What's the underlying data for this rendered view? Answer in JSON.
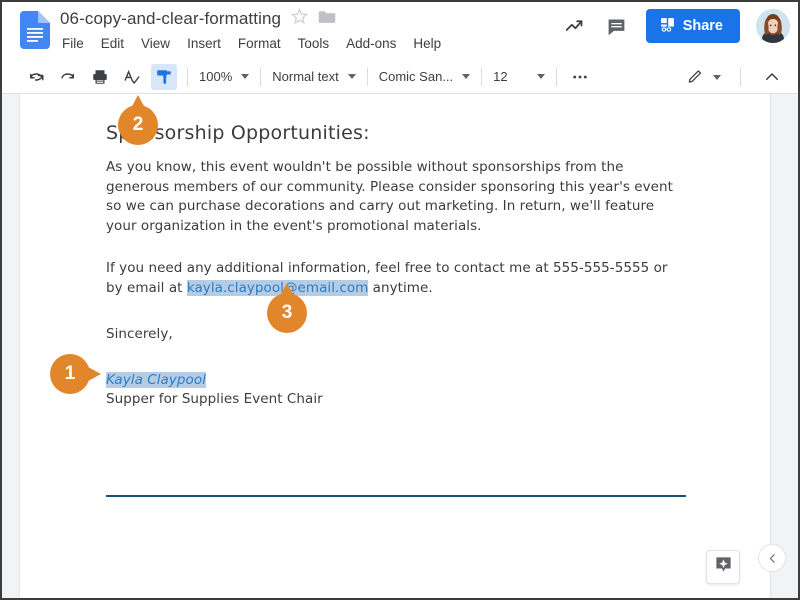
{
  "window": {
    "app": "Google Docs"
  },
  "header": {
    "doc_icon": "google-docs-icon",
    "title": "06-copy-and-clear-formatting",
    "star_icon": "star-outline-icon",
    "folder_icon": "folder-icon",
    "menus": [
      {
        "label": "File"
      },
      {
        "label": "Edit"
      },
      {
        "label": "View"
      },
      {
        "label": "Insert"
      },
      {
        "label": "Format"
      },
      {
        "label": "Tools"
      },
      {
        "label": "Add-ons"
      },
      {
        "label": "Help"
      }
    ],
    "activity_icon": "trending-up-icon",
    "comment_icon": "comment-icon",
    "share": {
      "label": "Share",
      "icon": "share-lock-icon",
      "color": "#1a73e8"
    },
    "avatar": "user-avatar"
  },
  "toolbar": {
    "undo_icon": "undo-icon",
    "redo_icon": "redo-icon",
    "print_icon": "print-icon",
    "spellcheck_icon": "spellcheck-icon",
    "paint_format_icon": "paint-format-icon",
    "paint_format_active": true,
    "zoom_value": "100%",
    "style_value": "Normal text",
    "font_value": "Comic San...",
    "size_value": "12",
    "more_icon": "more-horizontal-icon",
    "edit_mode_icon": "pencil-icon",
    "collapse_icon": "chevron-up-icon"
  },
  "document": {
    "heading": "Sponsorship Opportunities:",
    "paragraph1": "As you know, this event wouldn't be possible without sponsorships from the generous members of our community. Please consider sponsoring this year's event so we can purchase decorations and carry out marketing. In return, we'll feature your organization in the event's promotional materials.",
    "paragraph2_before": "If you need any additional information, feel free to contact me at 555-555-5555 or by email at ",
    "email_link": "kayla.claypool@email.com",
    "paragraph2_after": " anytime.",
    "closing": "Sincerely,",
    "signature_name": "Kayla Claypool",
    "signature_title": "Supper for Supplies Event Chair",
    "selection_color": "#b4cde5",
    "link_color": "#2e7cc4",
    "rule_color": "#1a5276"
  },
  "callouts": [
    {
      "number": "1",
      "color": "#e2862c"
    },
    {
      "number": "2",
      "color": "#e2862c"
    },
    {
      "number": "3",
      "color": "#e2862c"
    }
  ],
  "footer": {
    "explore_icon": "explore-icon",
    "panel_toggle_icon": "chevron-left-icon"
  }
}
